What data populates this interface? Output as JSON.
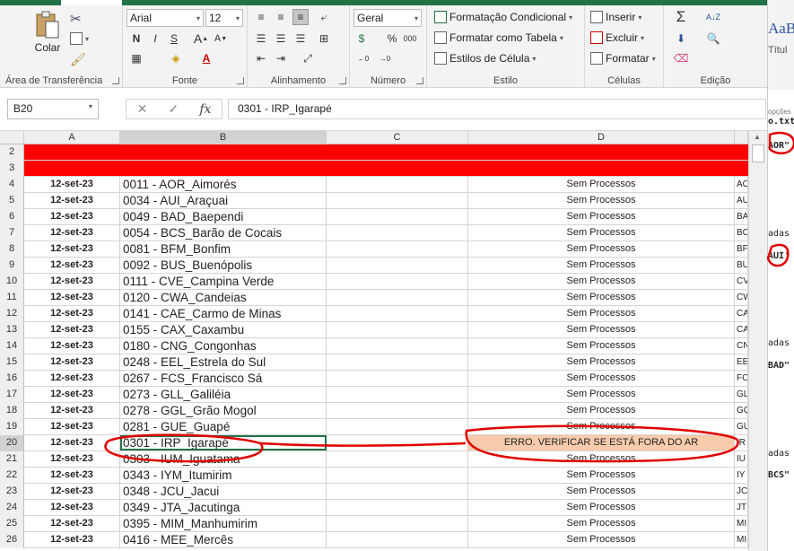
{
  "ribbon": {
    "clipboard": {
      "paste_label": "Colar",
      "group_label": "Área de Transferência"
    },
    "font": {
      "name": "Arial",
      "size": "12",
      "bold": "N",
      "italic": "I",
      "underline": "S",
      "group_label": "Fonte"
    },
    "alignment": {
      "group_label": "Alinhamento"
    },
    "number": {
      "format": "Geral",
      "percent": "%",
      "thousands": "000",
      "dec_inc": ",0\n,00",
      "group_label": "Número"
    },
    "styles": {
      "conditional": "Formatação Condicional",
      "as_table": "Formatar como Tabela",
      "cell_styles": "Estilos de Célula",
      "group_label": "Estilo"
    },
    "cells": {
      "insert": "Inserir",
      "delete": "Excluir",
      "format": "Formatar",
      "group_label": "Células"
    },
    "editing": {
      "group_label": "Edição"
    }
  },
  "formula_bar": {
    "name_box": "B20",
    "formula": "0301 -  IRP_Igarapé"
  },
  "columns": [
    "A",
    "B",
    "C",
    "D"
  ],
  "rows": [
    {
      "n": "2",
      "type": "red"
    },
    {
      "n": "3",
      "type": "red"
    },
    {
      "n": "4",
      "a": "12-set-23",
      "b": "0011 -  AOR_Aimorés",
      "d": "Sem Processos",
      "e": "AO"
    },
    {
      "n": "5",
      "a": "12-set-23",
      "b": "0034 -  AUI_Araçuai",
      "d": "Sem Processos",
      "e": "AU"
    },
    {
      "n": "6",
      "a": "12-set-23",
      "b": "0049 -  BAD_Baependi",
      "d": "Sem Processos",
      "e": "BA"
    },
    {
      "n": "7",
      "a": "12-set-23",
      "b": "0054 -  BCS_Barão de Cocais",
      "d": "Sem Processos",
      "e": "BC"
    },
    {
      "n": "8",
      "a": "12-set-23",
      "b": "0081 -  BFM_Bonfim",
      "d": "Sem Processos",
      "e": "BF"
    },
    {
      "n": "9",
      "a": "12-set-23",
      "b": "0092 -  BUS_Buenópolis",
      "d": "Sem Processos",
      "e": "BU"
    },
    {
      "n": "10",
      "a": "12-set-23",
      "b": "0111 -  CVE_Campina Verde",
      "d": "Sem Processos",
      "e": "CV"
    },
    {
      "n": "11",
      "a": "12-set-23",
      "b": "0120 -  CWA_Candeias",
      "d": "Sem Processos",
      "e": "CW"
    },
    {
      "n": "12",
      "a": "12-set-23",
      "b": "0141 -  CAE_Carmo de Minas",
      "d": "Sem Processos",
      "e": "CA"
    },
    {
      "n": "13",
      "a": "12-set-23",
      "b": "0155 -  CAX_Caxambu",
      "d": "Sem Processos",
      "e": "CA"
    },
    {
      "n": "14",
      "a": "12-set-23",
      "b": "0180 -  CNG_Congonhas",
      "d": "Sem Processos",
      "e": "CN"
    },
    {
      "n": "15",
      "a": "12-set-23",
      "b": "0248 -  EEL_Estrela do Sul",
      "d": "Sem Processos",
      "e": "EE"
    },
    {
      "n": "16",
      "a": "12-set-23",
      "b": "0267 -  FCS_Francisco Sá",
      "d": "Sem Processos",
      "e": "FC"
    },
    {
      "n": "17",
      "a": "12-set-23",
      "b": "0273 -  GLL_Galiléia",
      "d": "Sem Processos",
      "e": "GL"
    },
    {
      "n": "18",
      "a": "12-set-23",
      "b": "0278 -  GGL_Grão Mogol",
      "d": "Sem Processos",
      "e": "GG"
    },
    {
      "n": "19",
      "a": "12-set-23",
      "b": "0281 -  GUE_Guapé",
      "d": "Sem Processos",
      "e": "GU"
    },
    {
      "n": "20",
      "a": "12-set-23",
      "b": "0301 -  IRP_Igarapé",
      "d": "ERRO. VERIFICAR SE ESTÁ FORA DO AR",
      "e": "IR",
      "error": true
    },
    {
      "n": "21",
      "a": "12-set-23",
      "b": "0303 -  IUM_Iguatama",
      "d": "Sem Processos",
      "e": "IU"
    },
    {
      "n": "22",
      "a": "12-set-23",
      "b": "0343 -  IYM_Itumirim",
      "d": "Sem Processos",
      "e": "IY"
    },
    {
      "n": "23",
      "a": "12-set-23",
      "b": "0348 -  JCU_Jacui",
      "d": "Sem Processos",
      "e": "JC"
    },
    {
      "n": "24",
      "a": "12-set-23",
      "b": "0349 -  JTA_Jacutinga",
      "d": "Sem Processos",
      "e": "JT"
    },
    {
      "n": "25",
      "a": "12-set-23",
      "b": "0395 -  MIM_Manhumirim",
      "d": "Sem Processos",
      "e": "MI"
    },
    {
      "n": "26",
      "a": "12-set-23",
      "b": "0416 -  MEE_Mercês",
      "d": "Sem Processos",
      "e": "MI"
    }
  ],
  "right_window": {
    "style_preview": "AaB",
    "style_label": "Títul",
    "options": "opções",
    "file": "o.txt",
    "snippets": [
      "AOR\"",
      "adas",
      "AUI'",
      "adas",
      "BAD\"",
      "adas",
      "BCS\""
    ]
  }
}
